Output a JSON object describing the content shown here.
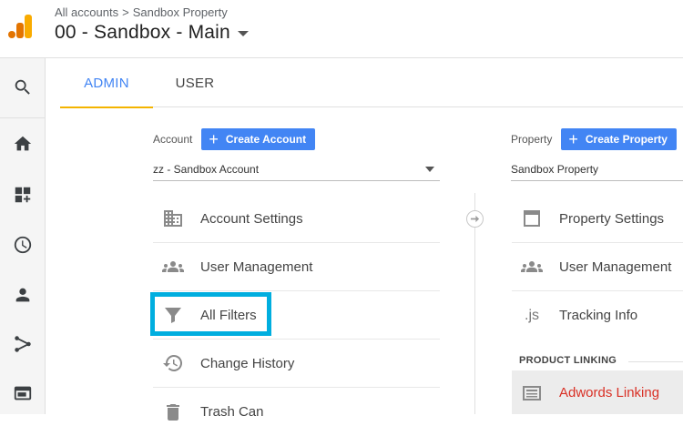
{
  "header": {
    "breadcrumb": [
      "All accounts",
      "Sandbox Property"
    ],
    "breadcrumb_sep": ">",
    "title": "00 - Sandbox - Main"
  },
  "rail": {
    "icons": [
      "search-icon",
      "home-icon",
      "dashboards-icon",
      "clock-icon",
      "person-icon",
      "share-icon",
      "browser-icon"
    ]
  },
  "tabs": [
    {
      "label": "ADMIN",
      "active": true
    },
    {
      "label": "USER",
      "active": false
    }
  ],
  "account": {
    "label": "Account",
    "create_label": "Create Account",
    "selected": "zz - Sandbox Account",
    "items": [
      {
        "label": "Account Settings",
        "icon": "building-icon"
      },
      {
        "label": "User Management",
        "icon": "people-icon"
      },
      {
        "label": "All Filters",
        "icon": "filter-icon"
      },
      {
        "label": "Change History",
        "icon": "history-icon"
      },
      {
        "label": "Trash Can",
        "icon": "trash-icon"
      }
    ]
  },
  "property": {
    "label": "Property",
    "create_label": "Create Property",
    "selected": "Sandbox Property",
    "items": [
      {
        "label": "Property Settings",
        "icon": "window-icon"
      },
      {
        "label": "User Management",
        "icon": "people-icon"
      },
      {
        "label": "Tracking Info",
        "icon": "js-icon",
        "icon_text": ".js"
      }
    ],
    "section_label": "PRODUCT LINKING",
    "linking_items": [
      {
        "label": "Adwords Linking",
        "icon": "adwords-icon",
        "selected": true
      }
    ]
  },
  "colors": {
    "accent": "#4285f4",
    "tab_underline": "#f4b400",
    "highlight": "#00aedf",
    "link_red": "#d93025"
  }
}
